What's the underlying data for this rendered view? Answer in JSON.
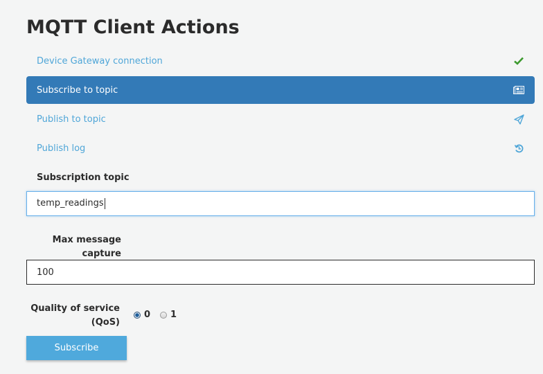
{
  "page": {
    "title": "MQTT Client Actions"
  },
  "nav": {
    "items": [
      {
        "label": "Device Gateway connection",
        "icon": "check-icon",
        "active": false
      },
      {
        "label": "Subscribe to topic",
        "icon": "newspaper-icon",
        "active": true
      },
      {
        "label": "Publish to topic",
        "icon": "paper-plane-icon",
        "active": false
      },
      {
        "label": "Publish log",
        "icon": "history-icon",
        "active": false
      }
    ]
  },
  "form": {
    "subscription_topic": {
      "label": "Subscription topic",
      "value": "temp_readings"
    },
    "max_message_capture": {
      "label_line1": "Max message",
      "label_line2": "capture",
      "value": "100"
    },
    "qos": {
      "label_line1": "Quality of service",
      "label_line2": "(QoS)",
      "options": [
        "0",
        "1"
      ],
      "selected": "0"
    },
    "submit_label": "Subscribe"
  },
  "colors": {
    "accent": "#337ab7",
    "link": "#4fa6d8",
    "button": "#4fa9dc",
    "success": "#3c9a2e"
  }
}
